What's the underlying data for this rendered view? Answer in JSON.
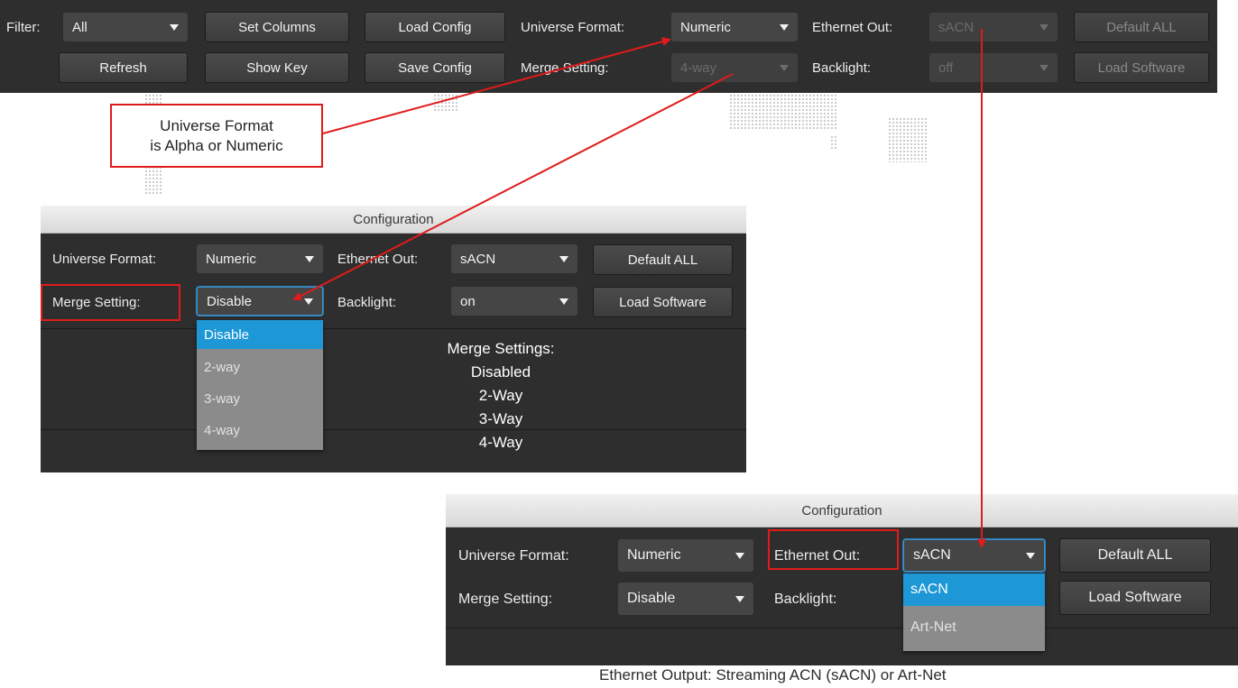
{
  "toolbar": {
    "filter_label": "Filter:",
    "filter_value": "All",
    "set_columns": "Set Columns",
    "load_config": "Load Config",
    "universe_format_label": "Universe Format:",
    "universe_format_value": "Numeric",
    "ethernet_out_label": "Ethernet Out:",
    "ethernet_out_value": "sACN",
    "default_all": "Default ALL",
    "refresh": "Refresh",
    "show_key": "Show Key",
    "save_config": "Save Config",
    "merge_setting_label": "Merge Setting:",
    "merge_setting_value": "4-way",
    "backlight_label": "Backlight:",
    "backlight_value": "off",
    "load_software": "Load Software"
  },
  "callout_universe": {
    "line1": "Universe Format",
    "line2": "is Alpha or Numeric"
  },
  "panel_merge": {
    "title": "Configuration",
    "universe_format_label": "Universe Format:",
    "universe_format_value": "Numeric",
    "ethernet_out_label": "Ethernet Out:",
    "ethernet_out_value": "sACN",
    "default_all": "Default ALL",
    "merge_setting_label": "Merge Setting:",
    "merge_setting_value": "Disable",
    "backlight_label": "Backlight:",
    "backlight_value": "on",
    "load_software": "Load Software",
    "dropdown_options": [
      "Disable",
      "2-way",
      "3-way",
      "4-way"
    ],
    "note_lines": [
      "Merge Settings:",
      "Disabled",
      "2-Way",
      "3-Way",
      "4-Way"
    ]
  },
  "panel_ethernet": {
    "title": "Configuration",
    "universe_format_label": "Universe Format:",
    "universe_format_value": "Numeric",
    "ethernet_out_label": "Ethernet Out:",
    "ethernet_out_value": "sACN",
    "default_all": "Default ALL",
    "merge_setting_label": "Merge Setting:",
    "merge_setting_value": "Disable",
    "backlight_label": "Backlight:",
    "load_software": "Load Software",
    "dropdown_options": [
      "sACN",
      "Art-Net"
    ]
  },
  "caption": "Ethernet Output: Streaming ACN (sACN) or Art-Net",
  "colors": {
    "annotation_red": "#e01b1b",
    "selection_blue": "#1d97d6",
    "ui_dark": "#2e2e2e"
  }
}
